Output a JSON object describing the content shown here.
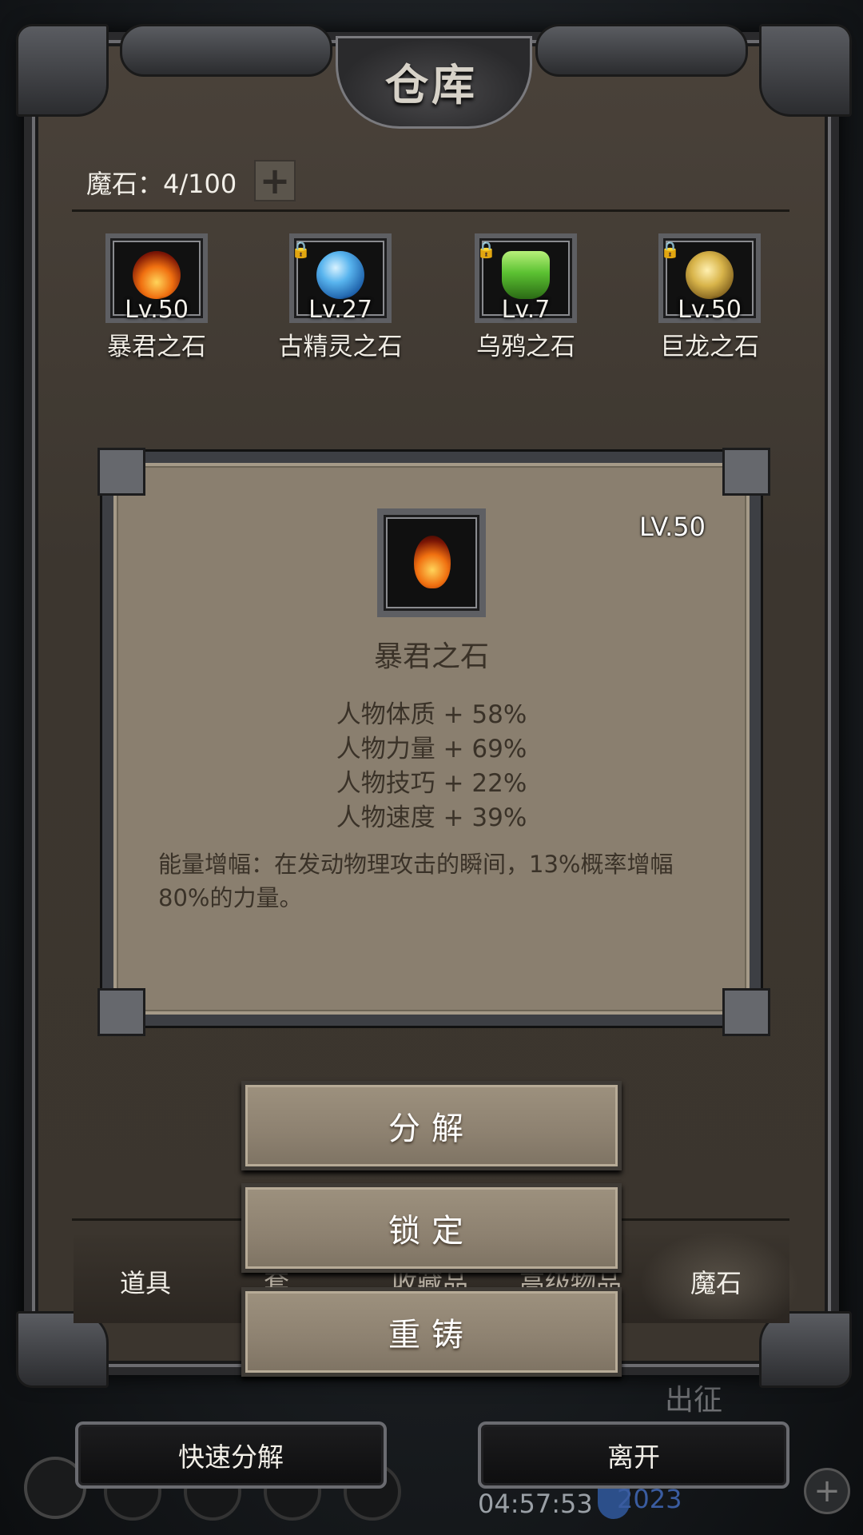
{
  "window": {
    "title": "仓库"
  },
  "header": {
    "stone_label": "魔石：4/100",
    "add_icon": "plus-icon"
  },
  "slots": [
    {
      "level": "Lv.50",
      "name": "暴君之石",
      "locked": false,
      "gem_color": "#e8631a"
    },
    {
      "level": "Lv.27",
      "name": "古精灵之石",
      "locked": true,
      "gem_color": "#2e8fd6"
    },
    {
      "level": "Lv.7",
      "name": "乌鸦之石",
      "locked": true,
      "gem_color": "#5cc232"
    },
    {
      "level": "Lv.50",
      "name": "巨龙之石",
      "locked": true,
      "gem_color": "#c9a43a"
    }
  ],
  "detail": {
    "level": "LV.50",
    "name": "暴君之石",
    "stats": [
      "人物体质 + 58%",
      "人物力量 + 69%",
      "人物技巧 + 22%",
      "人物速度 + 39%"
    ],
    "description": "能量增幅：在发动物理攻击的瞬间，13%概率增幅80%的力量。"
  },
  "actions": {
    "decompose": "分解",
    "lock": "锁定",
    "reforge": "重铸"
  },
  "tabs": [
    {
      "label": "道具"
    },
    {
      "label": "套"
    },
    {
      "label": "收藏品"
    },
    {
      "label": "高级物品"
    },
    {
      "label": "魔石"
    }
  ],
  "footer": {
    "quick_decompose": "快速分解",
    "leave": "离开"
  },
  "hud": {
    "time": "04:57:53",
    "level": "2023",
    "expedition": "出征"
  }
}
